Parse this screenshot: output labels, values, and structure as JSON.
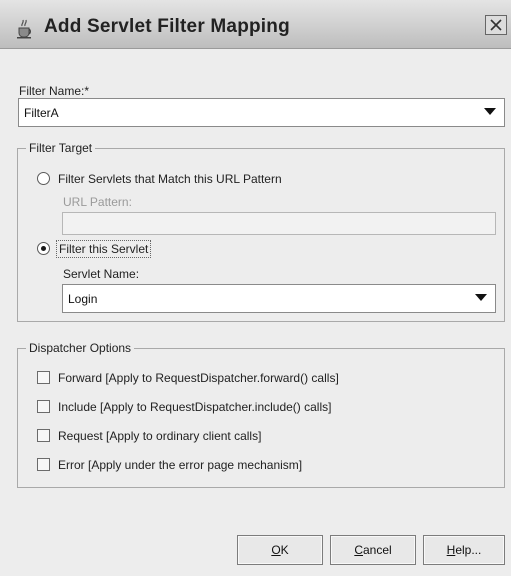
{
  "window": {
    "title": "Add Servlet Filter Mapping",
    "icon": "java-cup-icon",
    "close_icon": "close-icon"
  },
  "filter_name": {
    "label": "Filter Name:*",
    "value": "FilterA"
  },
  "filter_target": {
    "group_title": "Filter Target",
    "option_url_pattern": {
      "label": "Filter Servlets that Match this URL Pattern",
      "selected": false
    },
    "url_pattern": {
      "label": "URL Pattern:",
      "value": ""
    },
    "option_servlet": {
      "label": "Filter this Servlet",
      "selected": true
    },
    "servlet_name": {
      "label": "Servlet Name:",
      "value": "Login"
    }
  },
  "dispatcher_options": {
    "group_title": "Dispatcher Options",
    "items": [
      {
        "label": "Forward [Apply to RequestDispatcher.forward() calls]",
        "checked": false
      },
      {
        "label": "Include [Apply to RequestDispatcher.include() calls]",
        "checked": false
      },
      {
        "label": "Request [Apply to ordinary client calls]",
        "checked": false
      },
      {
        "label": "Error [Apply under the error page mechanism]",
        "checked": false
      }
    ]
  },
  "buttons": {
    "ok_label": "OK",
    "ok_mnemonic": "O",
    "ok_rest": "K",
    "cancel_label": "Cancel",
    "cancel_mnemonic": "C",
    "cancel_rest": "ancel",
    "help_label": "Help...",
    "help_mnemonic": "H",
    "help_rest": "elp..."
  }
}
